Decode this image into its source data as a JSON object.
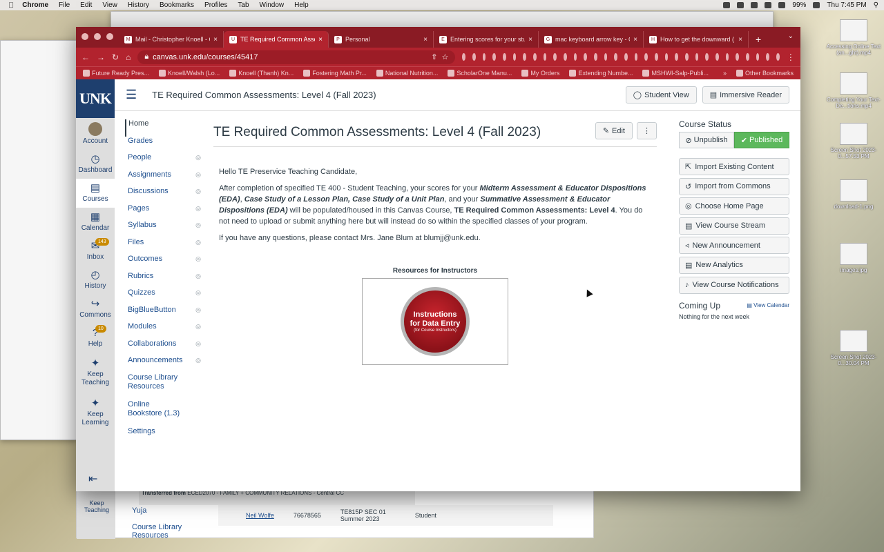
{
  "menubar": {
    "app": "Chrome",
    "items": [
      "File",
      "Edit",
      "View",
      "History",
      "Bookmarks",
      "Profiles",
      "Tab",
      "Window",
      "Help"
    ],
    "battery": "99%",
    "clock": "Thu 7:45 PM"
  },
  "desktop_files": [
    "Accessing Online Text (an...ght).mp4",
    "Completing Your Text-De...tions.mp4",
    "Screen Shot 2023-0...57.53 PM",
    "download-1.png",
    "images.jpg",
    "Screen Shot 2023-0...30.04 PM"
  ],
  "tabs": [
    {
      "label": "Mail - Christopher Knoell - O",
      "fav": "M",
      "active": false
    },
    {
      "label": "TE Required Common Assess",
      "fav": "U",
      "active": true
    },
    {
      "label": "Personal",
      "fav": "P",
      "active": false
    },
    {
      "label": "Entering scores for your stud",
      "fav": "E",
      "active": false
    },
    {
      "label": "mac keyboard arrow key - Go",
      "fav": "G",
      "active": false
    },
    {
      "label": "How to get the downward (↓",
      "fav": "H",
      "active": false
    }
  ],
  "url": "canvas.unk.edu/courses/45417",
  "bookmarks": [
    "Future Ready Pres...",
    "Knoell/Walsh (Lo...",
    "Knoell (Thanh) Kn...",
    "Fostering Math Pr...",
    "National Nutrition...",
    "ScholarOne Manu...",
    "My Orders",
    "Extending Numbe...",
    "MSHWI-Salp-Publi...",
    "Other Bookmarks"
  ],
  "logo": "UNK",
  "globalnav": [
    {
      "label": "Account",
      "icon": "avatar"
    },
    {
      "label": "Dashboard",
      "icon": "◷"
    },
    {
      "label": "Courses",
      "icon": "▤"
    },
    {
      "label": "Calendar",
      "icon": "▦"
    },
    {
      "label": "Inbox",
      "icon": "✉",
      "badge": "143"
    },
    {
      "label": "History",
      "icon": "◴"
    },
    {
      "label": "Commons",
      "icon": "↪"
    },
    {
      "label": "Help",
      "icon": "?",
      "badge": "10"
    },
    {
      "label": "Keep Teaching",
      "icon": "✦"
    },
    {
      "label": "Keep Learning",
      "icon": "✦"
    }
  ],
  "header": {
    "breadcrumb": "TE Required Common Assessments: Level 4 (Fall 2023)",
    "student_view": "Student View",
    "immersive_reader": "Immersive Reader"
  },
  "coursenav": [
    {
      "label": "Home",
      "hidden": false
    },
    {
      "label": "Grades",
      "hidden": false
    },
    {
      "label": "People",
      "hidden": true
    },
    {
      "label": "Assignments",
      "hidden": true
    },
    {
      "label": "Discussions",
      "hidden": true
    },
    {
      "label": "Pages",
      "hidden": true
    },
    {
      "label": "Syllabus",
      "hidden": true
    },
    {
      "label": "Files",
      "hidden": true
    },
    {
      "label": "Outcomes",
      "hidden": true
    },
    {
      "label": "Rubrics",
      "hidden": true
    },
    {
      "label": "Quizzes",
      "hidden": true
    },
    {
      "label": "BigBlueButton",
      "hidden": true
    },
    {
      "label": "Modules",
      "hidden": true
    },
    {
      "label": "Collaborations",
      "hidden": true
    },
    {
      "label": "Announcements",
      "hidden": true
    },
    {
      "label": "Course Library Resources",
      "hidden": false
    },
    {
      "label": "Online Bookstore (1.3)",
      "hidden": false
    },
    {
      "label": "Settings",
      "hidden": false
    }
  ],
  "main": {
    "title": "TE Required Common Assessments: Level 4 (Fall 2023)",
    "edit": "Edit",
    "greeting": "Hello TE Preservice Teaching Candidate,",
    "para_a": "After completion of specified TE 400 - Student Teaching, your scores for your ",
    "b1": "Midterm Assessment & Educator Dispositions (EDA)",
    "para_b": ", ",
    "b2": "Case Study of a Lesson Plan, Case Study of a Unit Plan",
    "para_c": ", and your ",
    "b3": "Summative Assessment & Educator Dispositions (EDA)",
    "para_d": " will be populated/housed in this Canvas Course, ",
    "b4": "TE Required Common Assessments: Level 4",
    "para_e": ". You do not need to upload or submit anything here but will instead do so within the specified classes of your program.",
    "contact": "If you have any questions, please contact Mrs. Jane Blum at blumjj@unk.edu.",
    "resources_caption": "Resources for Instructors",
    "button_line1": "Instructions",
    "button_line2": "for Data Entry",
    "button_line3": "(for Course Instructors)"
  },
  "sidebar": {
    "status_heading": "Course Status",
    "unpublish": "Unpublish",
    "published": "Published",
    "actions": [
      "Import Existing Content",
      "Import from Commons",
      "Choose Home Page",
      "View Course Stream",
      "New Announcement",
      "New Analytics",
      "View Course Notifications"
    ],
    "coming_up": "Coming Up",
    "view_calendar": "View Calendar",
    "nothing": "Nothing for the next week"
  },
  "lower": {
    "items": [
      "Keep Teaching",
      "Yuja",
      "Course Library Resources"
    ],
    "row_name": "Neil Wolfe",
    "row_id": "76678565",
    "row_section": "TE815P SEC 01 Summer 2023",
    "row_role": "Student",
    "transferred": "Transferred from",
    "transferred_course": "ECED2070 - FAMILY + COMMUNITY RELATIONS - Central CC"
  }
}
